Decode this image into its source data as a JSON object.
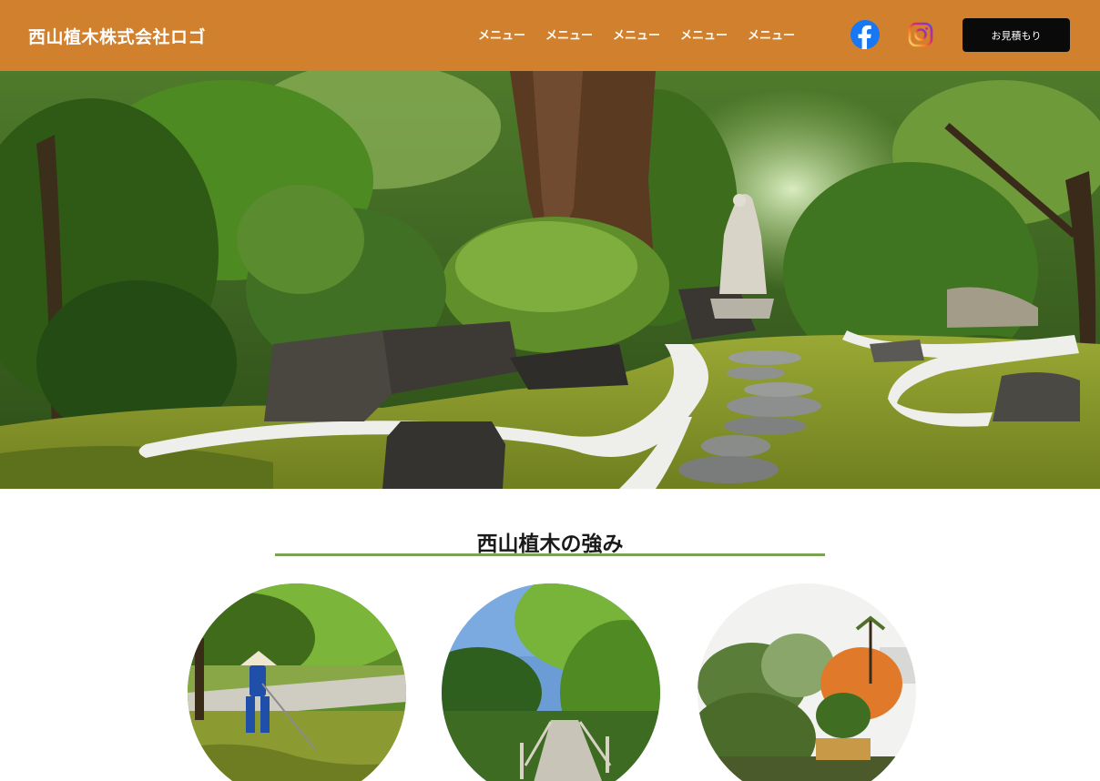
{
  "header": {
    "logo_text": "西山植木株式会社ロゴ",
    "nav": [
      "メニュー",
      "メニュー",
      "メニュー",
      "メニュー",
      "メニュー"
    ],
    "social": [
      "facebook-icon",
      "instagram-icon"
    ],
    "cta_label": "お見積もり"
  },
  "hero": {
    "image": "japanese-garden-hero-image"
  },
  "strengths": {
    "title": "西山植木の強み",
    "images": [
      "gardener-raking-image",
      "garden-bridge-image",
      "garden-trees-image"
    ]
  },
  "colors": {
    "header_bg": "#D1802E",
    "cta_bg": "#0a0a0a",
    "accent_rule": "#7CA353"
  }
}
